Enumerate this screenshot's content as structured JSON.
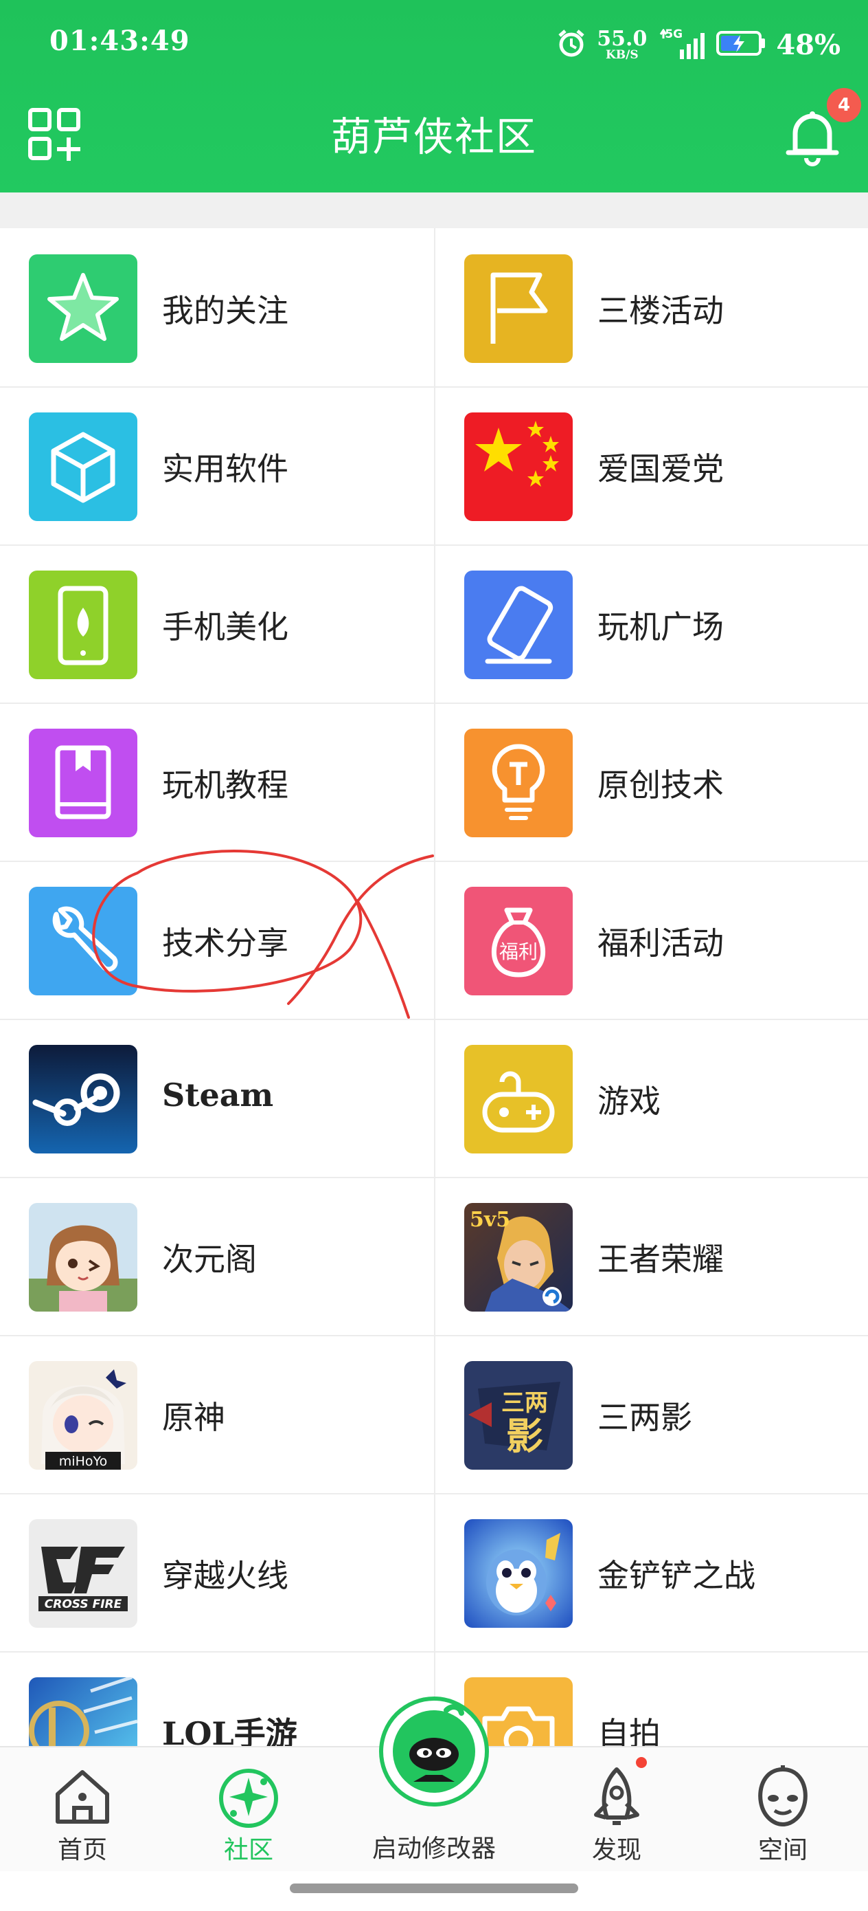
{
  "status_bar": {
    "time": "01:43:49",
    "net_speed_value": "55.0",
    "net_speed_unit": "KB/S",
    "network": "5G",
    "battery": "48%"
  },
  "header": {
    "title": "葫芦侠社区",
    "notification_count": "4",
    "accent": "#22c55e"
  },
  "categories": [
    {
      "label": "我的关注",
      "icon": "star-icon",
      "color": "#2ecc71"
    },
    {
      "label": "三楼活动",
      "icon": "flag-icon",
      "color": "#e6b422"
    },
    {
      "label": "实用软件",
      "icon": "cube-icon",
      "color": "#2bbfe3"
    },
    {
      "label": "爱国爱党",
      "icon": "china-flag-icon",
      "color": "#ee1c25"
    },
    {
      "label": "手机美化",
      "icon": "phone-leaf-icon",
      "color": "#8fd12a"
    },
    {
      "label": "玩机广场",
      "icon": "phone-tilt-icon",
      "color": "#4a7cf0"
    },
    {
      "label": "玩机教程",
      "icon": "book-icon",
      "color": "#c04ef0"
    },
    {
      "label": "原创技术",
      "icon": "bulb-icon",
      "color": "#f7922f"
    },
    {
      "label": "技术分享",
      "icon": "wrench-icon",
      "color": "#3fa6f0"
    },
    {
      "label": "福利活动",
      "icon": "money-bag-icon",
      "color": "#f05577"
    },
    {
      "label": "Steam",
      "icon": "steam-icon",
      "color": "#1b3f6e"
    },
    {
      "label": "游戏",
      "icon": "gamepad-icon",
      "color": "#e7c128"
    },
    {
      "label": "次元阁",
      "icon": "anime-girl-icon",
      "color": "#f3d2a8"
    },
    {
      "label": "王者荣耀",
      "icon": "honor-of-kings-icon",
      "color": "#33406b"
    },
    {
      "label": "原神",
      "icon": "genshin-paimon-icon",
      "color": "#f5efe6"
    },
    {
      "label": "三两影",
      "icon": "sanliangying-icon",
      "color": "#2b3a66"
    },
    {
      "label": "穿越火线",
      "icon": "crossfire-icon",
      "color": "#e9e9e9"
    },
    {
      "label": "金铲铲之战",
      "icon": "tft-penguin-icon",
      "color": "#2f6ee0"
    },
    {
      "label": "LOL手游",
      "icon": "lol-icon",
      "color": "#2aa8e8"
    },
    {
      "label": "自拍",
      "icon": "camera-icon",
      "color": "#f6b73c"
    }
  ],
  "icon_text": {
    "fuli": "福利",
    "sanliangying_top": "三两",
    "sanliangying_bottom": "影",
    "genshin_brand": "miHoYo",
    "crossfire_brand": "CROSS FIRE",
    "wzry_badge": "5v5"
  },
  "bottom_nav": {
    "home": "首页",
    "community": "社区",
    "launch": "启动修改器",
    "discover": "发现",
    "space": "空间"
  }
}
